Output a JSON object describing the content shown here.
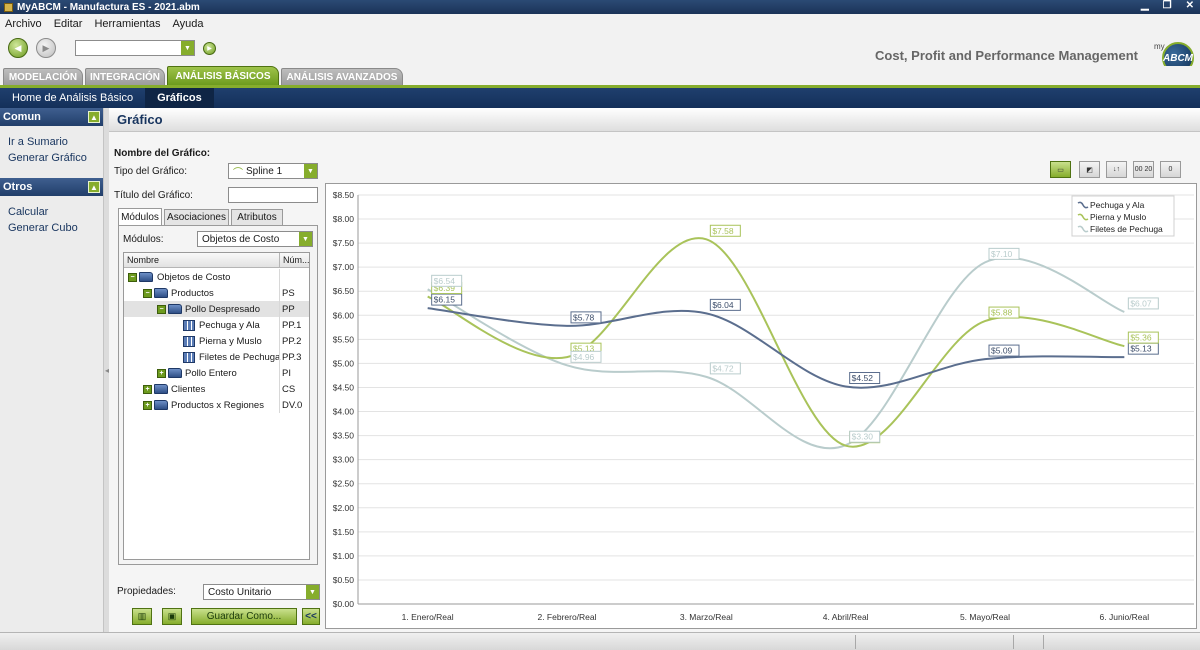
{
  "window": {
    "title": "MyABCM - Manufactura ES - 2021.abm"
  },
  "menu": [
    "Archivo",
    "Editar",
    "Herramientas",
    "Ayuda"
  ],
  "toolbar": {
    "tagline": "Cost, Profit and Performance Management",
    "logo_my": "my",
    "logo_text": "ABCM"
  },
  "module_tabs": [
    {
      "label": "MODELACIÓN",
      "active": false
    },
    {
      "label": "INTEGRACIÓN",
      "active": false
    },
    {
      "label": "ANÁLISIS BÁSICOS",
      "active": true
    },
    {
      "label": "ANÁLISIS AVANZADOS",
      "active": false
    }
  ],
  "subnav": [
    {
      "label": "Home de Análisis Básico",
      "active": false
    },
    {
      "label": "Gráficos",
      "active": true
    }
  ],
  "sidebar": {
    "sections": [
      {
        "title": "Comun",
        "items": [
          "Ir a Sumario",
          "Generar Gráfico"
        ]
      },
      {
        "title": "Otros",
        "items": [
          "Calcular",
          "Generar Cubo"
        ]
      }
    ]
  },
  "main": {
    "title": "Gráfico",
    "chart_name_label": "Nombre del Gráfico:",
    "chart_type_label": "Tipo del Gráfico:",
    "chart_type_value": "Spline 1",
    "chart_title_label": "Título del Gráfico:",
    "chart_title_value": "",
    "tabs": [
      "Módulos",
      "Asociaciones",
      "Atributos"
    ],
    "modules_label": "Módulos:",
    "modules_value": "Objetos de Costo",
    "tree_headers": [
      "Nombre",
      "Núm..."
    ],
    "tree_rows": [
      {
        "name": "Objetos de Costo",
        "code": ""
      },
      {
        "name": "Productos",
        "code": "PS"
      },
      {
        "name": "Pollo Despresado",
        "code": "PP"
      },
      {
        "name": "Pechuga y Ala",
        "code": "PP.1"
      },
      {
        "name": "Pierna y Muslo",
        "code": "PP.2"
      },
      {
        "name": "Filetes de Pechuga",
        "code": "PP.3"
      },
      {
        "name": "Pollo Entero",
        "code": "PI"
      },
      {
        "name": "Clientes",
        "code": "CS"
      },
      {
        "name": "Productos x Regiones",
        "code": "DV.0"
      }
    ],
    "properties_label": "Propiedades:",
    "properties_value": "Costo Unitario",
    "save_as_label": "Guardar Como...",
    "collapse_label": "<<",
    "chart_tools": [
      "▭",
      "◩",
      "↓↑",
      "00 20",
      "0"
    ]
  },
  "colors": {
    "series1": "#5b6e8e",
    "series2": "#a9c35a",
    "series3": "#b9cccc",
    "accent": "#86ad2c",
    "navy": "#14305a"
  },
  "chart_data": {
    "type": "line",
    "categories": [
      "1. Enero/Real",
      "2. Febrero/Real",
      "3. Marzo/Real",
      "4. Abril/Real",
      "5. Mayo/Real",
      "6. Junio/Real"
    ],
    "series": [
      {
        "name": "Pechuga y Ala",
        "values": [
          6.15,
          5.78,
          6.04,
          4.52,
          5.09,
          5.13
        ],
        "labels": [
          "$6.15",
          "$5.78",
          "$6.04",
          "$4.52",
          "$5.09",
          "$5.13"
        ]
      },
      {
        "name": "Pierna y Muslo",
        "values": [
          6.39,
          5.13,
          7.58,
          3.29,
          5.88,
          5.36
        ],
        "labels": [
          "$6.39",
          "$5.13",
          "$7.58",
          "$3.29",
          "$5.88",
          "$5.36"
        ]
      },
      {
        "name": "Filetes de Pechuga",
        "values": [
          6.54,
          4.96,
          4.72,
          3.3,
          7.1,
          6.07
        ],
        "labels": [
          "$6.54",
          "$4.96",
          "$4.72",
          "$3.30",
          "$7.10",
          "$6.07"
        ]
      }
    ],
    "ylim": [
      0,
      8.5
    ],
    "yticks": [
      0,
      0.5,
      1,
      1.5,
      2,
      2.5,
      3,
      3.5,
      4,
      4.5,
      5,
      5.5,
      6,
      6.5,
      7,
      7.5,
      8,
      8.5
    ],
    "ytick_labels": [
      "$0.00",
      "$0.50",
      "$1.00",
      "$1.50",
      "$2.00",
      "$2.50",
      "$3.00",
      "$3.50",
      "$4.00",
      "$4.50",
      "$5.00",
      "$5.50",
      "$6.00",
      "$6.50",
      "$7.00",
      "$7.50",
      "$8.00",
      "$8.50"
    ],
    "grid": true,
    "legend": "top-right",
    "curve": "spline"
  }
}
